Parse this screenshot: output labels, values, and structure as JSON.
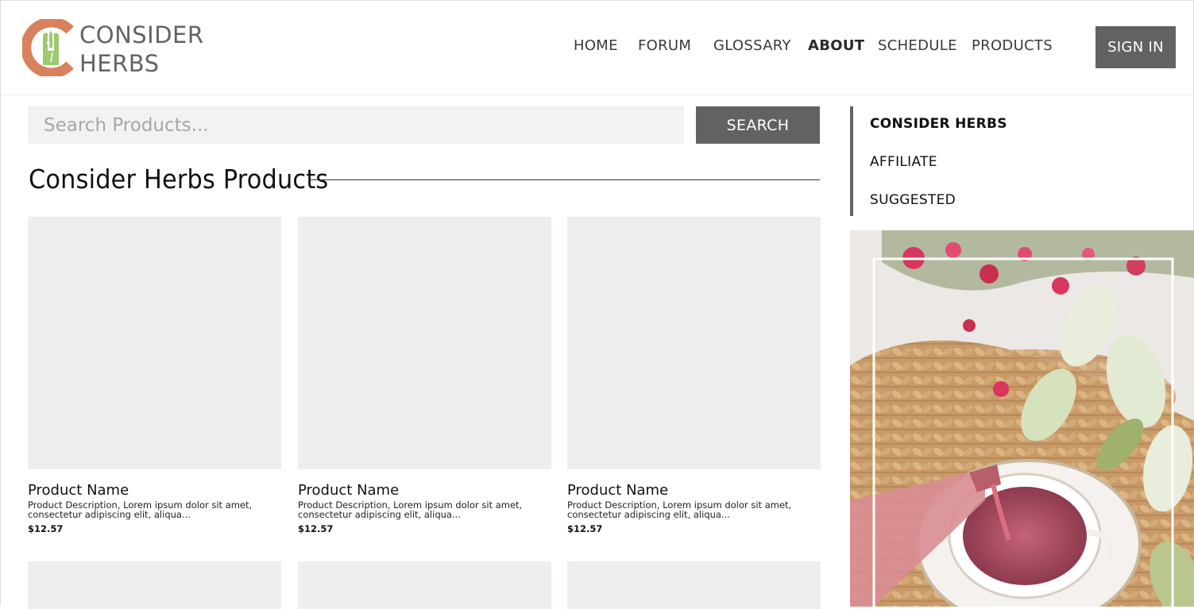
{
  "brand": {
    "line1": "CONSIDER",
    "line2": "HERBS",
    "colors": {
      "ring": "#d9805c",
      "leaf": "#9dc96f",
      "text": "#636363"
    }
  },
  "nav": {
    "items": [
      {
        "label": "HOME"
      },
      {
        "label": "FORUM"
      },
      {
        "label": "GLOSSARY"
      },
      {
        "label": "ABOUT",
        "active": true
      },
      {
        "label": "SCHEDULE"
      },
      {
        "label": "PRODUCTS"
      }
    ],
    "sign_in": "SIGN IN"
  },
  "search": {
    "placeholder": "Search Products...",
    "value": "",
    "button": "SEARCH"
  },
  "main": {
    "title": "Consider Herbs Products",
    "products": [
      {
        "name": "Product Name",
        "description": "Product Description, Lorem ipsum dolor sit amet, consectetur adipiscing elit, aliqua...",
        "price": "$12.57"
      },
      {
        "name": "Product Name",
        "description": "Product Description, Lorem ipsum dolor sit amet, consectetur adipiscing elit, aliqua...",
        "price": "$12.57"
      },
      {
        "name": "Product Name",
        "description": "Product Description, Lorem ipsum dolor sit amet, consectetur adipiscing elit, aliqua...",
        "price": "$12.57"
      }
    ]
  },
  "sidebar": {
    "items": [
      {
        "label": "CONSIDER HERBS",
        "active": true
      },
      {
        "label": "AFFILIATE"
      },
      {
        "label": "SUGGESTED"
      }
    ]
  },
  "colors": {
    "button_bg": "#626262",
    "placeholder_tile": "#efedee",
    "search_bg": "#f2f2f2"
  }
}
